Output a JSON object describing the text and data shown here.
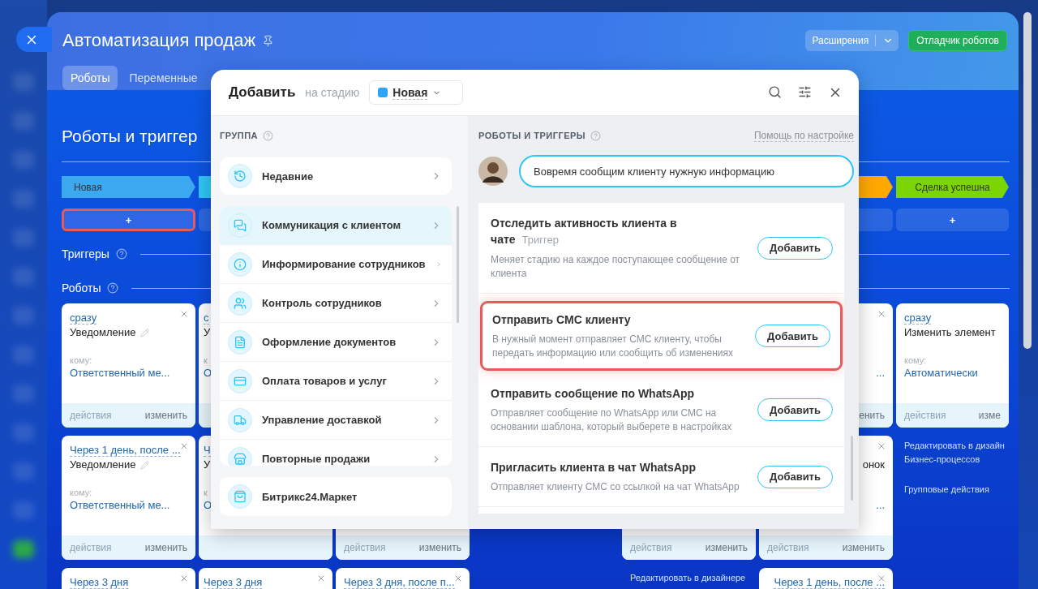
{
  "header": {
    "title": "Автоматизация продаж",
    "tabs": [
      {
        "label": "Роботы",
        "selected": true
      },
      {
        "label": "Переменные",
        "selected": false
      }
    ],
    "extensions_button": "Расширения",
    "debugger_button": "Отладчик роботов"
  },
  "board": {
    "heading": "Роботы и триггер",
    "sections": [
      "Триггеры",
      "Роботы"
    ],
    "columns": [
      {
        "kind": "stage",
        "stage": {
          "label": "Новая",
          "color": "#3ba8f0"
        },
        "add": {
          "label": "+",
          "highlighted": true
        },
        "cards": [
          {
            "kind": "robot",
            "delay": "сразу",
            "title": "Уведомление",
            "editable": true,
            "to_label": "кому:",
            "to_value": "Ответственный ме...",
            "actions": "действия",
            "edit": "изменить",
            "closable": true
          },
          {
            "kind": "robot",
            "delay": "Через 1 день, после ...",
            "title": "Уведомление",
            "editable": true,
            "to_label": "кому:",
            "to_value": "Ответственный ме...",
            "actions": "действия",
            "edit": "изменить",
            "closable": true
          },
          {
            "kind": "robot",
            "delay": "Через 3 дня",
            "closable": true
          }
        ]
      },
      {
        "kind": "left-strip",
        "stage": {
          "color": "#2fc6f6"
        },
        "add": {
          "highlighted": false
        },
        "cards": [
          {
            "kind": "robot",
            "delay": "с",
            "title": "У",
            "to_label": "к",
            "to_value": "О"
          },
          {
            "kind": "robot",
            "delay": "Ч",
            "title": "У",
            "to_label": "к",
            "to_value": "О"
          },
          {
            "kind": "robot",
            "delay": "Через 3 дня",
            "closable": true
          }
        ]
      },
      {
        "kind": "stage",
        "cards": [
          {
            "kind": "hidden"
          },
          {
            "kind": "robot",
            "actions": "действия",
            "edit": "изменить"
          },
          {
            "kind": "robot",
            "delay": "Через 3 дня, после п...",
            "closable": true
          }
        ]
      },
      {
        "kind": "hidden"
      },
      {
        "kind": "stage",
        "cards": [
          {
            "kind": "hidden"
          },
          {
            "kind": "robot",
            "actions": "действия",
            "edit": "изменить"
          }
        ],
        "links": [
          {
            "lines": [
              "Редактировать в дизайнере"
            ]
          }
        ]
      },
      {
        "kind": "right-strip",
        "stage": {
          "color": "#ffa900"
        },
        "add": {
          "highlighted": false
        },
        "cards": [
          {
            "kind": "robot",
            "to_value": "...",
            "edit": "енить",
            "closable": true
          },
          {
            "kind": "robot",
            "title": "онок",
            "to_value": "...",
            "actions": "действия",
            "edit": "изменить",
            "closable": true
          },
          {
            "kind": "robot",
            "delay": "Через 1 день, после ...",
            "closable": true
          }
        ]
      },
      {
        "kind": "stage",
        "stage": {
          "label": "Сделка успешна",
          "color": "#7bd500"
        },
        "add": {
          "label": "+",
          "highlighted": false
        },
        "cards": [
          {
            "kind": "robot",
            "delay": "сразу",
            "title": "Изменить элемент",
            "to_label": "кому:",
            "to_value": "Автоматически",
            "actions": "действия",
            "edit": "изме"
          }
        ],
        "links": [
          {
            "lines": [
              "Редактировать в дизайн",
              "Бизнес-процессов"
            ]
          },
          {
            "lines": [
              "Групповые действия"
            ]
          }
        ]
      }
    ]
  },
  "modal": {
    "title": "Добавить",
    "subtitle": "на стадию",
    "stage_select": {
      "label": "Новая",
      "color": "#2fa5f5"
    },
    "groups_label": "ГРУППА",
    "recent": {
      "label": "Недавние"
    },
    "groups": [
      {
        "label": "Коммуникация с клиентом",
        "kind": "chat",
        "selected": true
      },
      {
        "label": "Информирование сотрудников",
        "kind": "info",
        "selected": false
      },
      {
        "label": "Контроль сотрудников",
        "kind": "people",
        "selected": false
      },
      {
        "label": "Оформление документов",
        "kind": "document",
        "selected": false
      },
      {
        "label": "Оплата товаров и услуг",
        "kind": "payment",
        "selected": false
      },
      {
        "label": "Управление доставкой",
        "kind": "delivery",
        "selected": false
      },
      {
        "label": "Повторные продажи",
        "kind": "sales",
        "selected": false
      }
    ],
    "market": {
      "label": "Битрикс24.Маркет"
    },
    "robots_label": "РОБОТЫ И ТРИГГЕРЫ",
    "help_link": "Помощь по настройке",
    "hint": "Вовремя сообщим клиенту нужную информацию",
    "robots": [
      {
        "title": "Отследить активность клиента в чате",
        "tag": "Триггер",
        "description": "Меняет стадию на каждое поступающее сообщение от клиента",
        "button": "Добавить",
        "highlighted": false
      },
      {
        "title": "Отправить СМС клиенту",
        "description": "В нужный момент отправляет СМС клиенту, чтобы передать информацию или сообщить об изменениях",
        "button": "Добавить",
        "highlighted": true
      },
      {
        "title": "Отправить сообщение по WhatsApp",
        "description": "Отправляет сообщение по WhatsApp или СМС на основании шаблона, который выберете в настройках",
        "button": "Добавить",
        "highlighted": false
      },
      {
        "title": "Пригласить клиента в чат WhatsApp",
        "description": "Отправляет клиенту СМС со ссылкой на чат WhatsApp",
        "button": "Добавить",
        "highlighted": false
      }
    ]
  }
}
